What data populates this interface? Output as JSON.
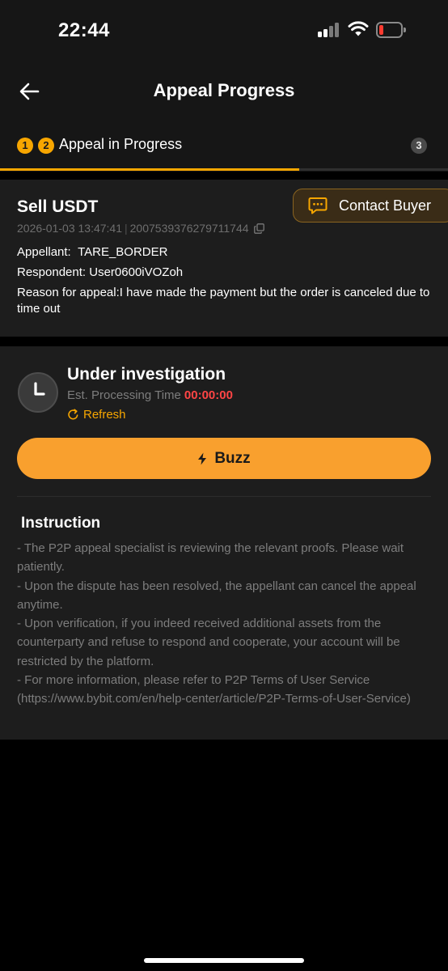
{
  "status_bar": {
    "time": "22:44",
    "signal_icon": "cellular-signal-icon",
    "wifi_icon": "wifi-icon",
    "battery_icon": "battery-low-icon",
    "battery_level": 0.15,
    "battery_color": "#ff3b30"
  },
  "nav": {
    "back_icon": "arrow-left-icon",
    "title": "Appeal Progress"
  },
  "steps": {
    "items": [
      {
        "number": "1",
        "state": "done"
      },
      {
        "number": "2",
        "state": "current"
      },
      {
        "number": "3",
        "state": "pending"
      }
    ],
    "current_label": "Appeal in Progress",
    "progress": 0.667,
    "accent_color": "#f7a600"
  },
  "order": {
    "title": "Sell USDT",
    "contact_button": "Contact Buyer",
    "contact_icon": "chat-icon",
    "datetime": "2026-01-03 13:47:41",
    "separator": "|",
    "order_id": "2007539376279711744",
    "copy_icon": "copy-icon",
    "appellant_label": "Appellant:",
    "appellant": "TARE_BORDER",
    "respondent_label": "Respondent:",
    "respondent": "User0600iVOZoh",
    "reason_label": "Reason for appeal:",
    "reason": "I have made the payment but the order is canceled due to time out"
  },
  "status": {
    "icon": "clock-icon",
    "title": "Under investigation",
    "est_label": "Est. Processing Time",
    "est_time": "00:00:00",
    "est_time_color": "#ff4545",
    "refresh_icon": "refresh-icon",
    "refresh_label": "Refresh",
    "buzz_icon": "lightning-icon",
    "buzz_label": "Buzz",
    "buzz_color": "#f9a02e"
  },
  "instruction": {
    "title": "Instruction",
    "lines": [
      "- The P2P appeal specialist is reviewing the relevant proofs. Please wait patiently.",
      "- Upon the dispute has been resolved, the appellant can cancel the appeal anytime.",
      "- Upon verification, if you indeed received additional assets from the counterparty and refuse to respond and cooperate, your account will be restricted by the platform.",
      "- For more information, please refer to P2P Terms of User Service (https://www.bybit.com/en/help-center/article/P2P-Terms-of-User-Service)"
    ]
  }
}
